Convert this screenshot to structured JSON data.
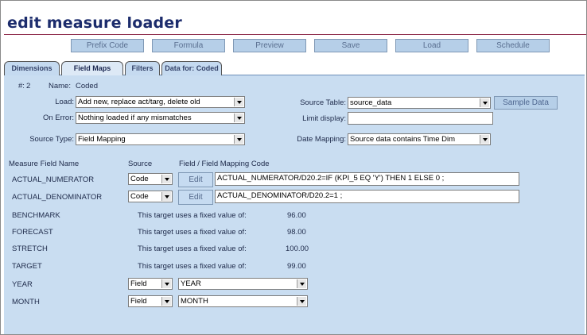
{
  "app": {
    "title": "edit measure loader"
  },
  "toolbar": {
    "buttons": [
      {
        "label": "Prefix Code"
      },
      {
        "label": "Formula"
      },
      {
        "label": "Preview"
      },
      {
        "label": "Save"
      },
      {
        "label": "Load"
      },
      {
        "label": "Schedule"
      }
    ]
  },
  "tabs": [
    {
      "label": "Dimensions",
      "active": false
    },
    {
      "label": "Field Maps",
      "active": true
    },
    {
      "label": "Filters",
      "active": false
    },
    {
      "label": "Data for: Coded",
      "active": false
    }
  ],
  "header_info": {
    "id_label": "#:",
    "id_value": "2",
    "name_label": "Name:",
    "name_value": "Coded"
  },
  "form": {
    "load_label": "Load:",
    "load_value": "Add new, replace act/targ, delete old",
    "on_error_label": "On Error:",
    "on_error_value": "Nothing loaded if any mismatches",
    "source_type_label": "Source Type:",
    "source_type_value": "Field Mapping",
    "source_table_label": "Source Table:",
    "source_table_value": "source_data",
    "sample_data_label": "Sample Data",
    "limit_display_label": "Limit display:",
    "limit_display_value": "",
    "date_mapping_label": "Date Mapping:",
    "date_mapping_value": "Source data contains Time Dim"
  },
  "mapping": {
    "headers": {
      "field_name": "Measure Field Name",
      "source": "Source",
      "code": "Field / Field Mapping Code"
    },
    "edit_label": "Edit",
    "fixed_prefix": "This target uses a fixed value of:",
    "rows": [
      {
        "name": "ACTUAL_NUMERATOR",
        "kind": "code",
        "source": "Code",
        "code": "ACTUAL_NUMERATOR/D20.2=IF (KPI_5 EQ 'Y') THEN 1 ELSE 0 ;"
      },
      {
        "name": "ACTUAL_DENOMINATOR",
        "kind": "code",
        "source": "Code",
        "code": "ACTUAL_DENOMINATOR/D20.2=1 ;"
      },
      {
        "name": "BENCHMARK",
        "kind": "fixed",
        "value": "96.00"
      },
      {
        "name": "FORECAST",
        "kind": "fixed",
        "value": "98.00"
      },
      {
        "name": "STRETCH",
        "kind": "fixed",
        "value": "100.00"
      },
      {
        "name": "TARGET",
        "kind": "fixed",
        "value": "99.00"
      },
      {
        "name": "YEAR",
        "kind": "field",
        "source": "Field",
        "field": "YEAR"
      },
      {
        "name": "MONTH",
        "kind": "field",
        "source": "Field",
        "field": "MONTH"
      }
    ]
  }
}
